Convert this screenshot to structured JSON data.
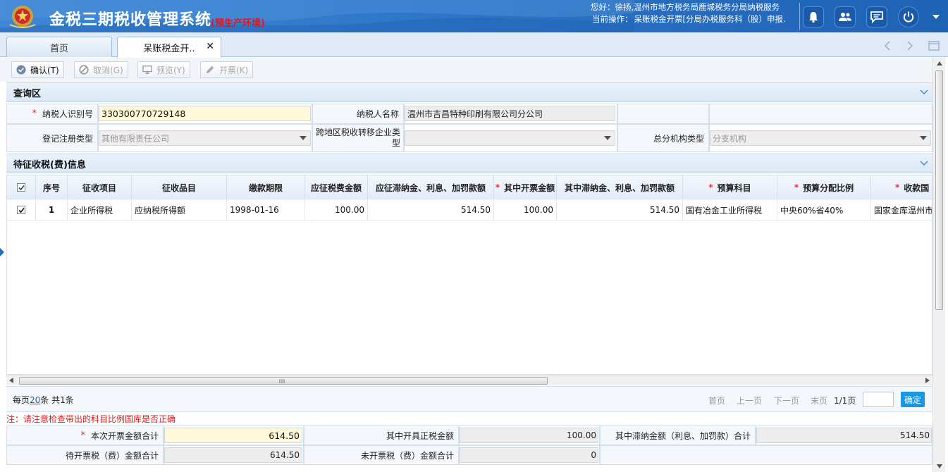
{
  "header": {
    "title": "金税三期税收管理系统",
    "env": "(预生产环境)",
    "user_line": "您好：徐扬,温州市地方税务局鹿城税务分局纳税服务",
    "op_label": "当前操作：",
    "op_value": "呆账税金开票[分局办税服务科（股）申报.",
    "icons": [
      "bell-icon",
      "users-icon",
      "chat-icon",
      "power-icon",
      "caret-down-icon"
    ],
    "accent": "#2e76c8"
  },
  "tabs": [
    {
      "label": "首页"
    },
    {
      "label": "呆账税金开..",
      "close": "✕"
    }
  ],
  "toolbar": {
    "confirm": "确认(T)",
    "cancel": "取消(G)",
    "preview": "预览(Y)",
    "issue": "开票(K)"
  },
  "query": {
    "title": "查询区",
    "taxpayer_id_label": "纳税人识别号",
    "taxpayer_id": "330300770729148",
    "taxpayer_name_label": "纳税人名称",
    "taxpayer_name": "温州市吉昌特种印刷有限公司分公司",
    "reg_type_label": "登记注册类型",
    "reg_type": "其他有限责任公司",
    "cross_region_label_1": "跨地区税收转移企业类",
    "cross_region_label_2": "型",
    "cross_region": "",
    "branch_type_label": "总分机构类型",
    "branch_type": "分支机构"
  },
  "pending": {
    "title": "待征收税(费)信息",
    "columns": [
      "序号",
      "征收项目",
      "征收品目",
      "缴款期限",
      "应征税费金额",
      "应征滞纳金、利息、加罚款额",
      "其中开票金额",
      "其中滞纳金、利息、加罚款额",
      "预算科目",
      "预算分配比例",
      "收款国"
    ],
    "rows": [
      [
        "1",
        "企业所得税",
        "应纳税所得额",
        "1998-01-16",
        "100.00",
        "514.50",
        "100.00",
        "514.50",
        "国有冶金工业所得税",
        "中央60%省40%",
        "国家金库温州市"
      ]
    ]
  },
  "pager": {
    "per_page_prefix": "每页",
    "per_page": "20",
    "per_page_suffix": "条 共1条",
    "first": "首页",
    "prev": "上一页",
    "next": "下一页",
    "last": "末页",
    "page_info": "1/1页",
    "go": "确定"
  },
  "note": "注：请注意检查带出的科目比例国库是否正确",
  "summary": {
    "current_total_label": "本次开票金额合计",
    "current_total": "614.50",
    "tax_part_label": "其中开具正税金额",
    "tax_part": "100.00",
    "late_fee_label": "其中滞纳金额（利息、加罚款）合计",
    "late_fee": "514.50",
    "pending_total_label": "待开票税（费）金额合计",
    "pending_total": "614.50",
    "unissued_label": "未开票税（费）金额合计",
    "unissued": "0"
  }
}
